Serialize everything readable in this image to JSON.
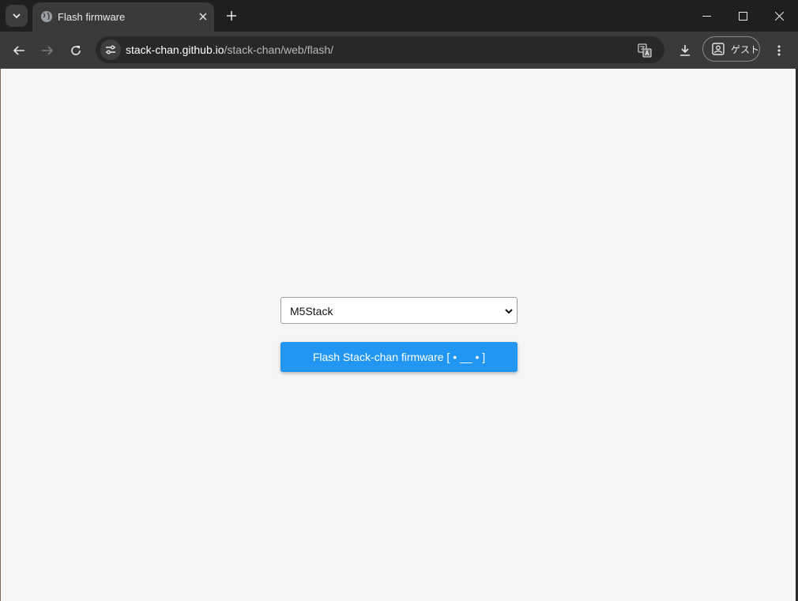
{
  "tab": {
    "title": "Flash firmware",
    "favicon_icon": "globe-icon"
  },
  "address_bar": {
    "url_host": "stack-chan.github.io",
    "url_path": "/stack-chan/web/flash/"
  },
  "profile": {
    "label": "ゲスト"
  },
  "page": {
    "board_select": {
      "selected": "M5Stack"
    },
    "flash_button_label": "Flash Stack-chan firmware [ • __ • ]"
  },
  "colors": {
    "accent": "#2196f3",
    "page_background": "#f5f5f5",
    "toolbar": "#3a3a3a",
    "tabstrip": "#1f1f1f"
  }
}
